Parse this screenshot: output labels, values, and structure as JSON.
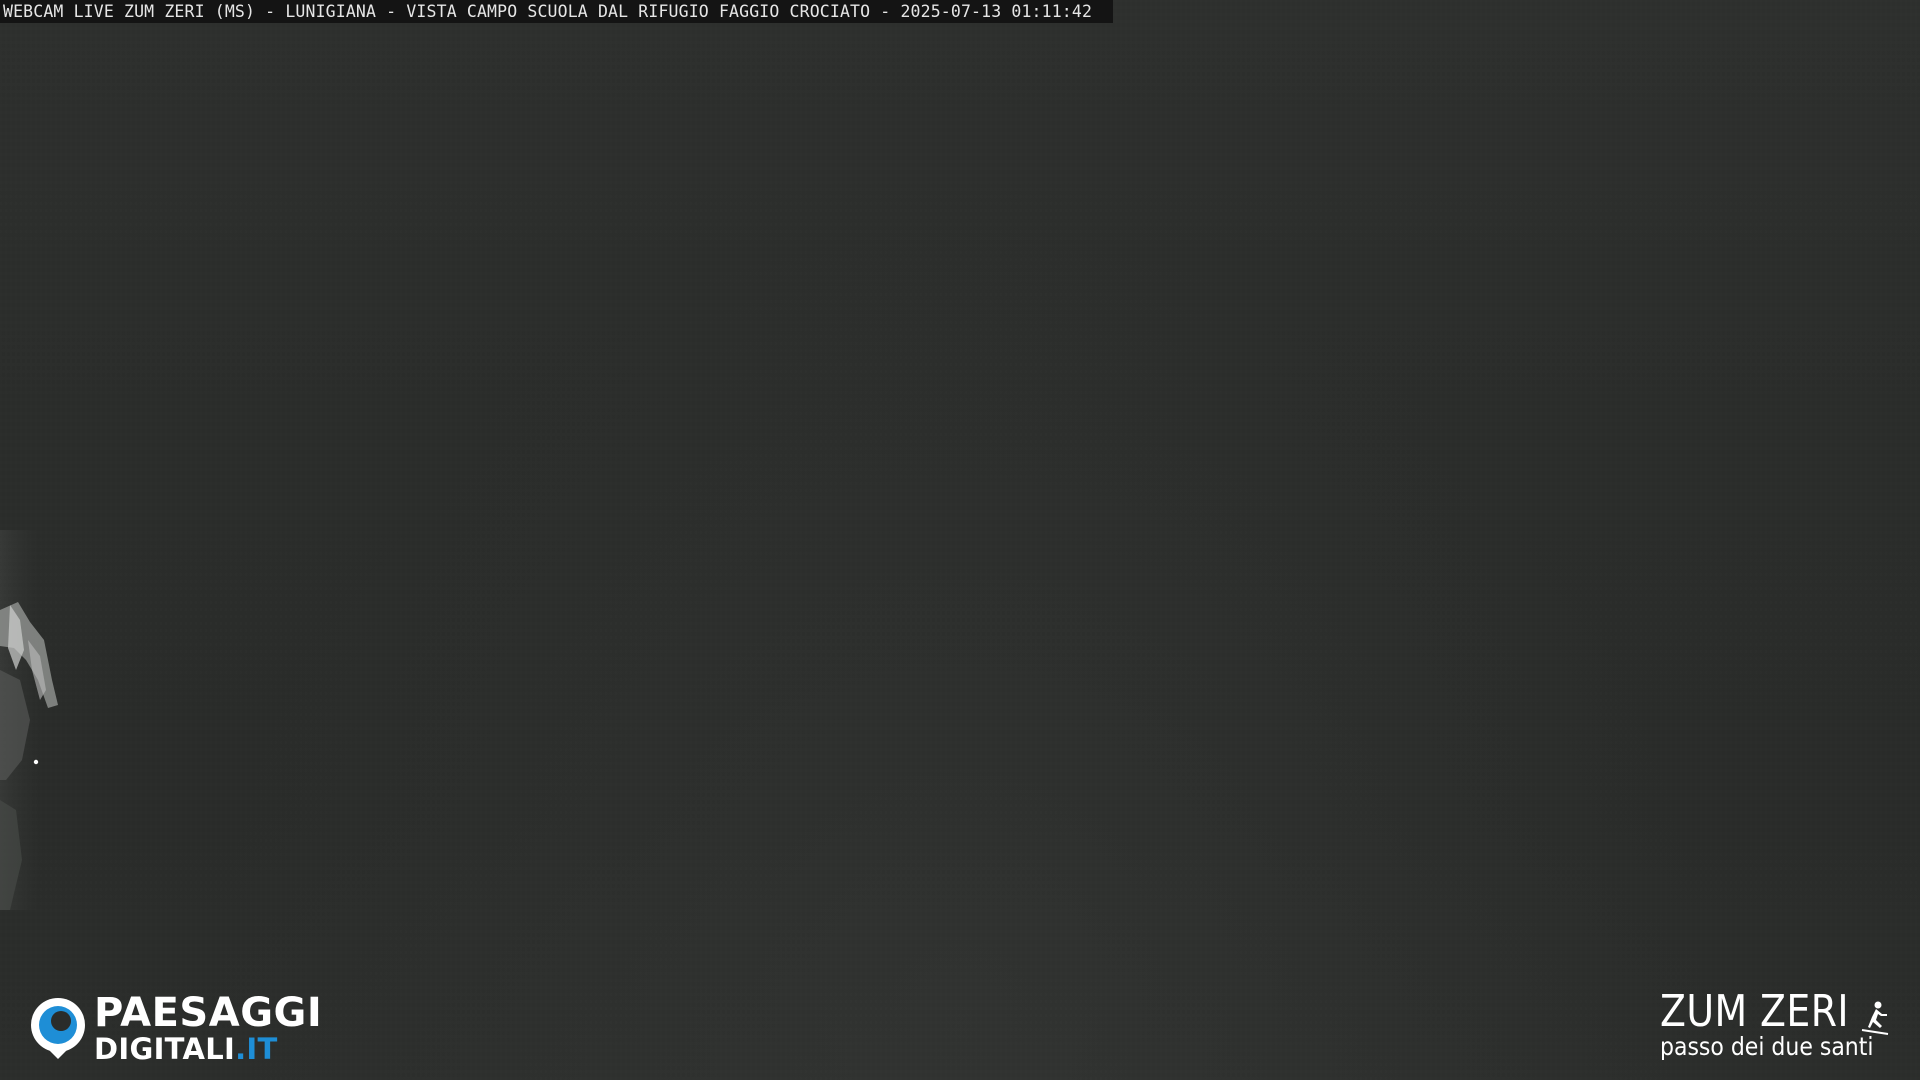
{
  "overlay": {
    "caption": "WEBCAM LIVE ZUM ZERI (MS) - LUNIGIANA - VISTA CAMPO SCUOLA DAL RIFUGIO FAGGIO CROCIATO - 2025-07-13 01:11:42"
  },
  "logos": {
    "left": {
      "line1": "PAESAGGI",
      "line2_main": "DIGITALI",
      "line2_suffix": ".IT",
      "icon": "eye-icon",
      "accent_color": "#1e8ed6"
    },
    "right": {
      "title": "ZUM ZERI",
      "subtitle": "passo dei due santi",
      "icon": "skier-icon"
    }
  },
  "colors": {
    "background": "#2a2c2a",
    "caption_bar": "#141414",
    "text": "#ffffff"
  }
}
